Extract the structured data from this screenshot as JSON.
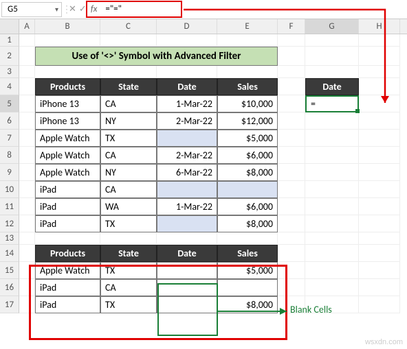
{
  "formula_bar": {
    "name_box": "G5",
    "formula": "=\"=\""
  },
  "columns": [
    "A",
    "B",
    "C",
    "D",
    "E",
    "F",
    "G",
    "H"
  ],
  "rows": [
    "1",
    "2",
    "3",
    "4",
    "5",
    "6",
    "7",
    "8",
    "9",
    "10",
    "11",
    "12",
    "13",
    "14",
    "15",
    "16",
    "17"
  ],
  "banner": "Use of '<>'  Symbol with Advanced Filter",
  "table1": {
    "headers": {
      "products": "Products",
      "state": "State",
      "date": "Date",
      "sales": "Sales"
    },
    "rows": [
      {
        "p": "iPhone 13",
        "s": "CA",
        "d": "1-Mar-22",
        "v": "$10,000"
      },
      {
        "p": "iPhone 13",
        "s": "NY",
        "d": "2-Mar-22",
        "v": "$12,000"
      },
      {
        "p": "Apple Watch",
        "s": "TX",
        "d": "",
        "v": "$5,000"
      },
      {
        "p": "Apple Watch",
        "s": "CA",
        "d": "2-Mar-22",
        "v": "$6,000"
      },
      {
        "p": "Apple Watch",
        "s": "NY",
        "d": "6-Mar-22",
        "v": "$8,000"
      },
      {
        "p": "iPad",
        "s": "CA",
        "d": "",
        "v": ""
      },
      {
        "p": "iPad",
        "s": "WA",
        "d": "1-Mar-22",
        "v": "$6,000"
      },
      {
        "p": "iPad",
        "s": "TX",
        "d": "",
        "v": "$8,000"
      }
    ]
  },
  "criteria": {
    "header": "Date",
    "value": "="
  },
  "table2": {
    "headers": {
      "products": "Products",
      "state": "State",
      "date": "Date",
      "sales": "Sales"
    },
    "rows": [
      {
        "p": "Apple Watch",
        "s": "TX",
        "d": "",
        "v": "$5,000"
      },
      {
        "p": "iPad",
        "s": "CA",
        "d": "",
        "v": ""
      },
      {
        "p": "iPad",
        "s": "TX",
        "d": "",
        "v": "$8,000"
      }
    ]
  },
  "annotation": {
    "blank": "Blank Cells"
  },
  "watermark": "wsxdn.com"
}
